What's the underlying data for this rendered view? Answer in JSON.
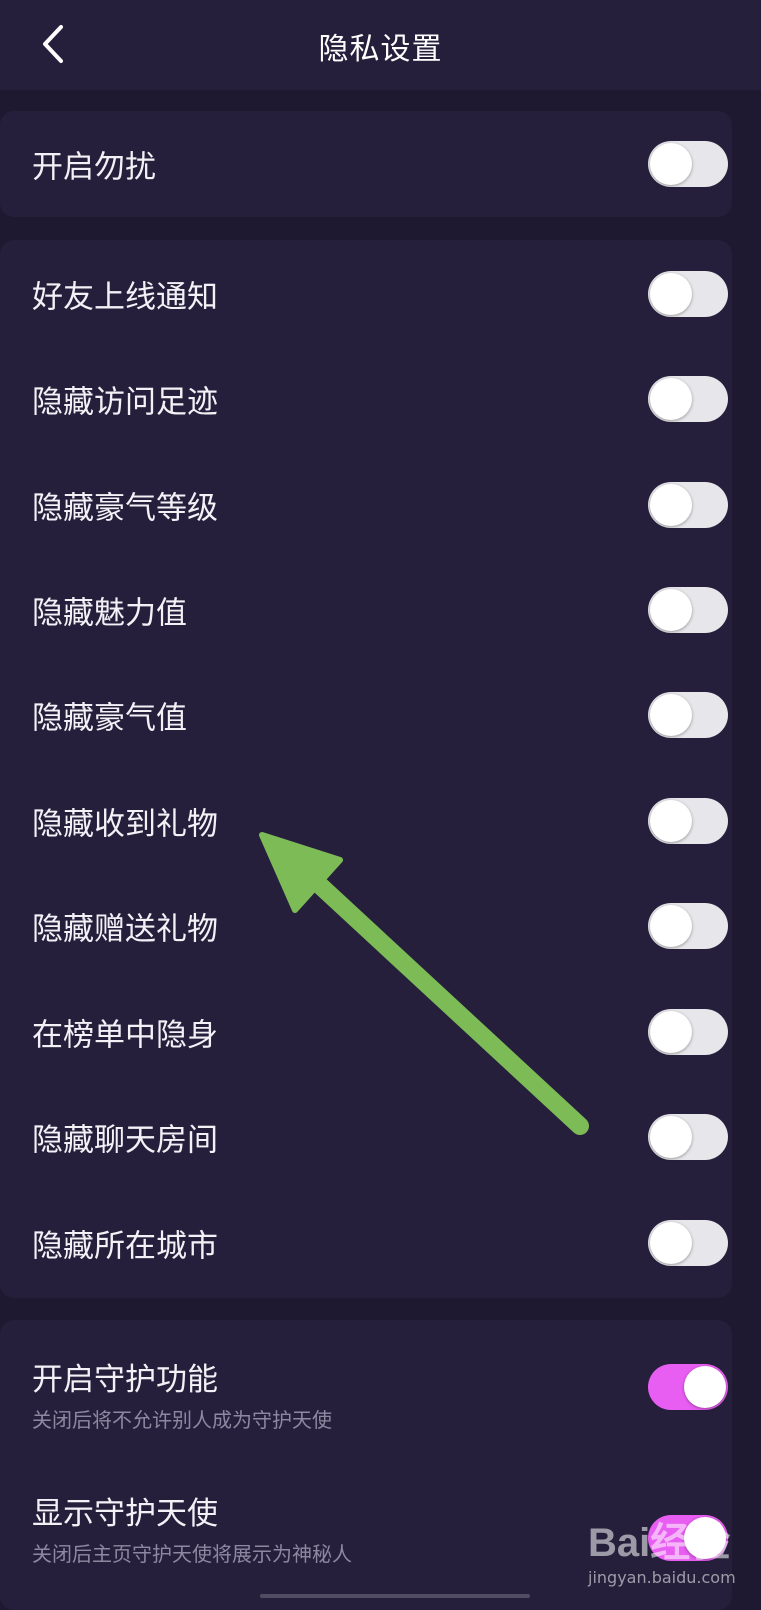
{
  "header": {
    "title": "隐私设置",
    "back_icon": "chevron-left-icon"
  },
  "sections": [
    {
      "items": [
        {
          "label": "开启勿扰",
          "enabled": false
        }
      ]
    },
    {
      "items": [
        {
          "label": "好友上线通知",
          "enabled": false
        },
        {
          "label": "隐藏访问足迹",
          "enabled": false
        },
        {
          "label": "隐藏豪气等级",
          "enabled": false
        },
        {
          "label": "隐藏魅力值",
          "enabled": false
        },
        {
          "label": "隐藏豪气值",
          "enabled": false
        },
        {
          "label": "隐藏收到礼物",
          "enabled": false
        },
        {
          "label": "隐藏赠送礼物",
          "enabled": false
        },
        {
          "label": "在榜单中隐身",
          "enabled": false
        },
        {
          "label": "隐藏聊天房间",
          "enabled": false
        },
        {
          "label": "隐藏所在城市",
          "enabled": false
        }
      ]
    },
    {
      "items": [
        {
          "label": "开启守护功能",
          "sublabel": "关闭后将不允许别人成为守护天使",
          "enabled": true
        },
        {
          "label": "显示守护天使",
          "sublabel": "关闭后主页守护天使将展示为神秘人",
          "enabled": true
        }
      ]
    }
  ],
  "annotation": {
    "arrow_color": "#7dbb57",
    "target": "隐藏收到礼物"
  },
  "watermark": {
    "logo": "Bai经验",
    "site": "jingyan.baidu.com"
  },
  "colors": {
    "background": "#1e1830",
    "card": "#261f3c",
    "toggle_off": "#e7e6ea",
    "toggle_on": "#e85ef2"
  }
}
